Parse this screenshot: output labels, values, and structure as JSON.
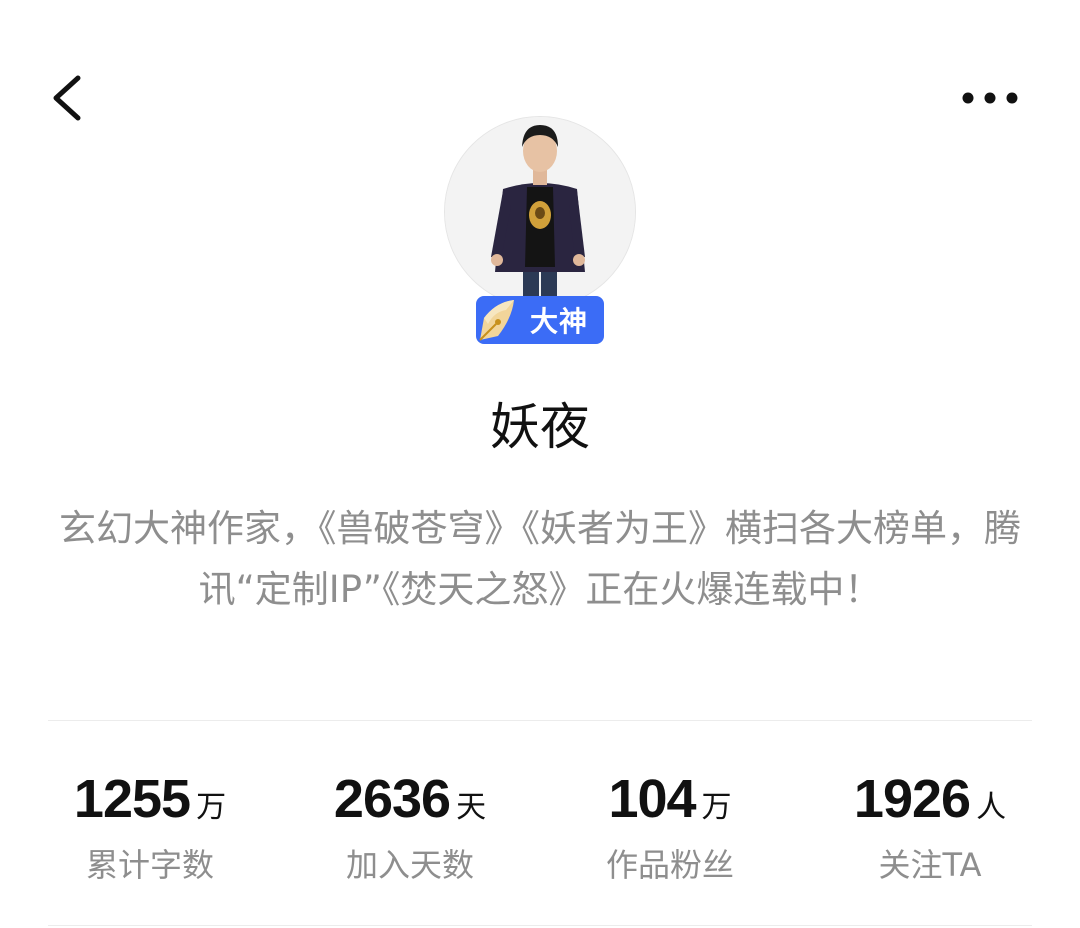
{
  "header": {
    "back_icon": "chevron-left-icon",
    "more_icon": "more-horizontal-icon"
  },
  "author": {
    "avatar_icon": "author-avatar",
    "badge_label": "大神",
    "badge_icon": "pen-nib-icon",
    "badge_color": "#3b6cf6",
    "name": "妖夜",
    "bio": "玄幻大神作家，《兽破苍穹》《妖者为王》横扫各大榜单，腾讯“定制IP”《焚天之怒》正在火爆连载中！"
  },
  "stats": [
    {
      "value": "1255",
      "unit": "万",
      "label": "累计字数"
    },
    {
      "value": "2636",
      "unit": "天",
      "label": "加入天数"
    },
    {
      "value": "104",
      "unit": "万",
      "label": "作品粉丝"
    },
    {
      "value": "1926",
      "unit": "人",
      "label": "关注TA"
    }
  ]
}
